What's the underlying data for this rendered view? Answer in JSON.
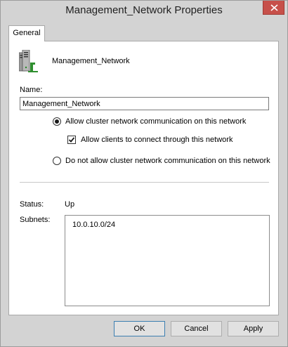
{
  "window": {
    "title": "Management_Network Properties",
    "close_icon": "close-icon"
  },
  "tabs": [
    {
      "label": "General",
      "selected": true
    }
  ],
  "general": {
    "network_icon": "server-network-icon",
    "network_name": "Management_Network",
    "name_label": "Name:",
    "name_value": "Management_Network",
    "options": {
      "allow_cluster": {
        "label": "Allow cluster network communication on this network",
        "selected": true
      },
      "allow_clients": {
        "label": "Allow clients to connect through this network",
        "checked": true
      },
      "do_not_allow": {
        "label": "Do not allow cluster network communication on this network",
        "selected": false
      }
    },
    "status_label": "Status:",
    "status_value": "Up",
    "subnets_label": "Subnets:",
    "subnets": [
      "10.0.10.0/24"
    ]
  },
  "buttons": {
    "ok": "OK",
    "cancel": "Cancel",
    "apply": "Apply"
  }
}
